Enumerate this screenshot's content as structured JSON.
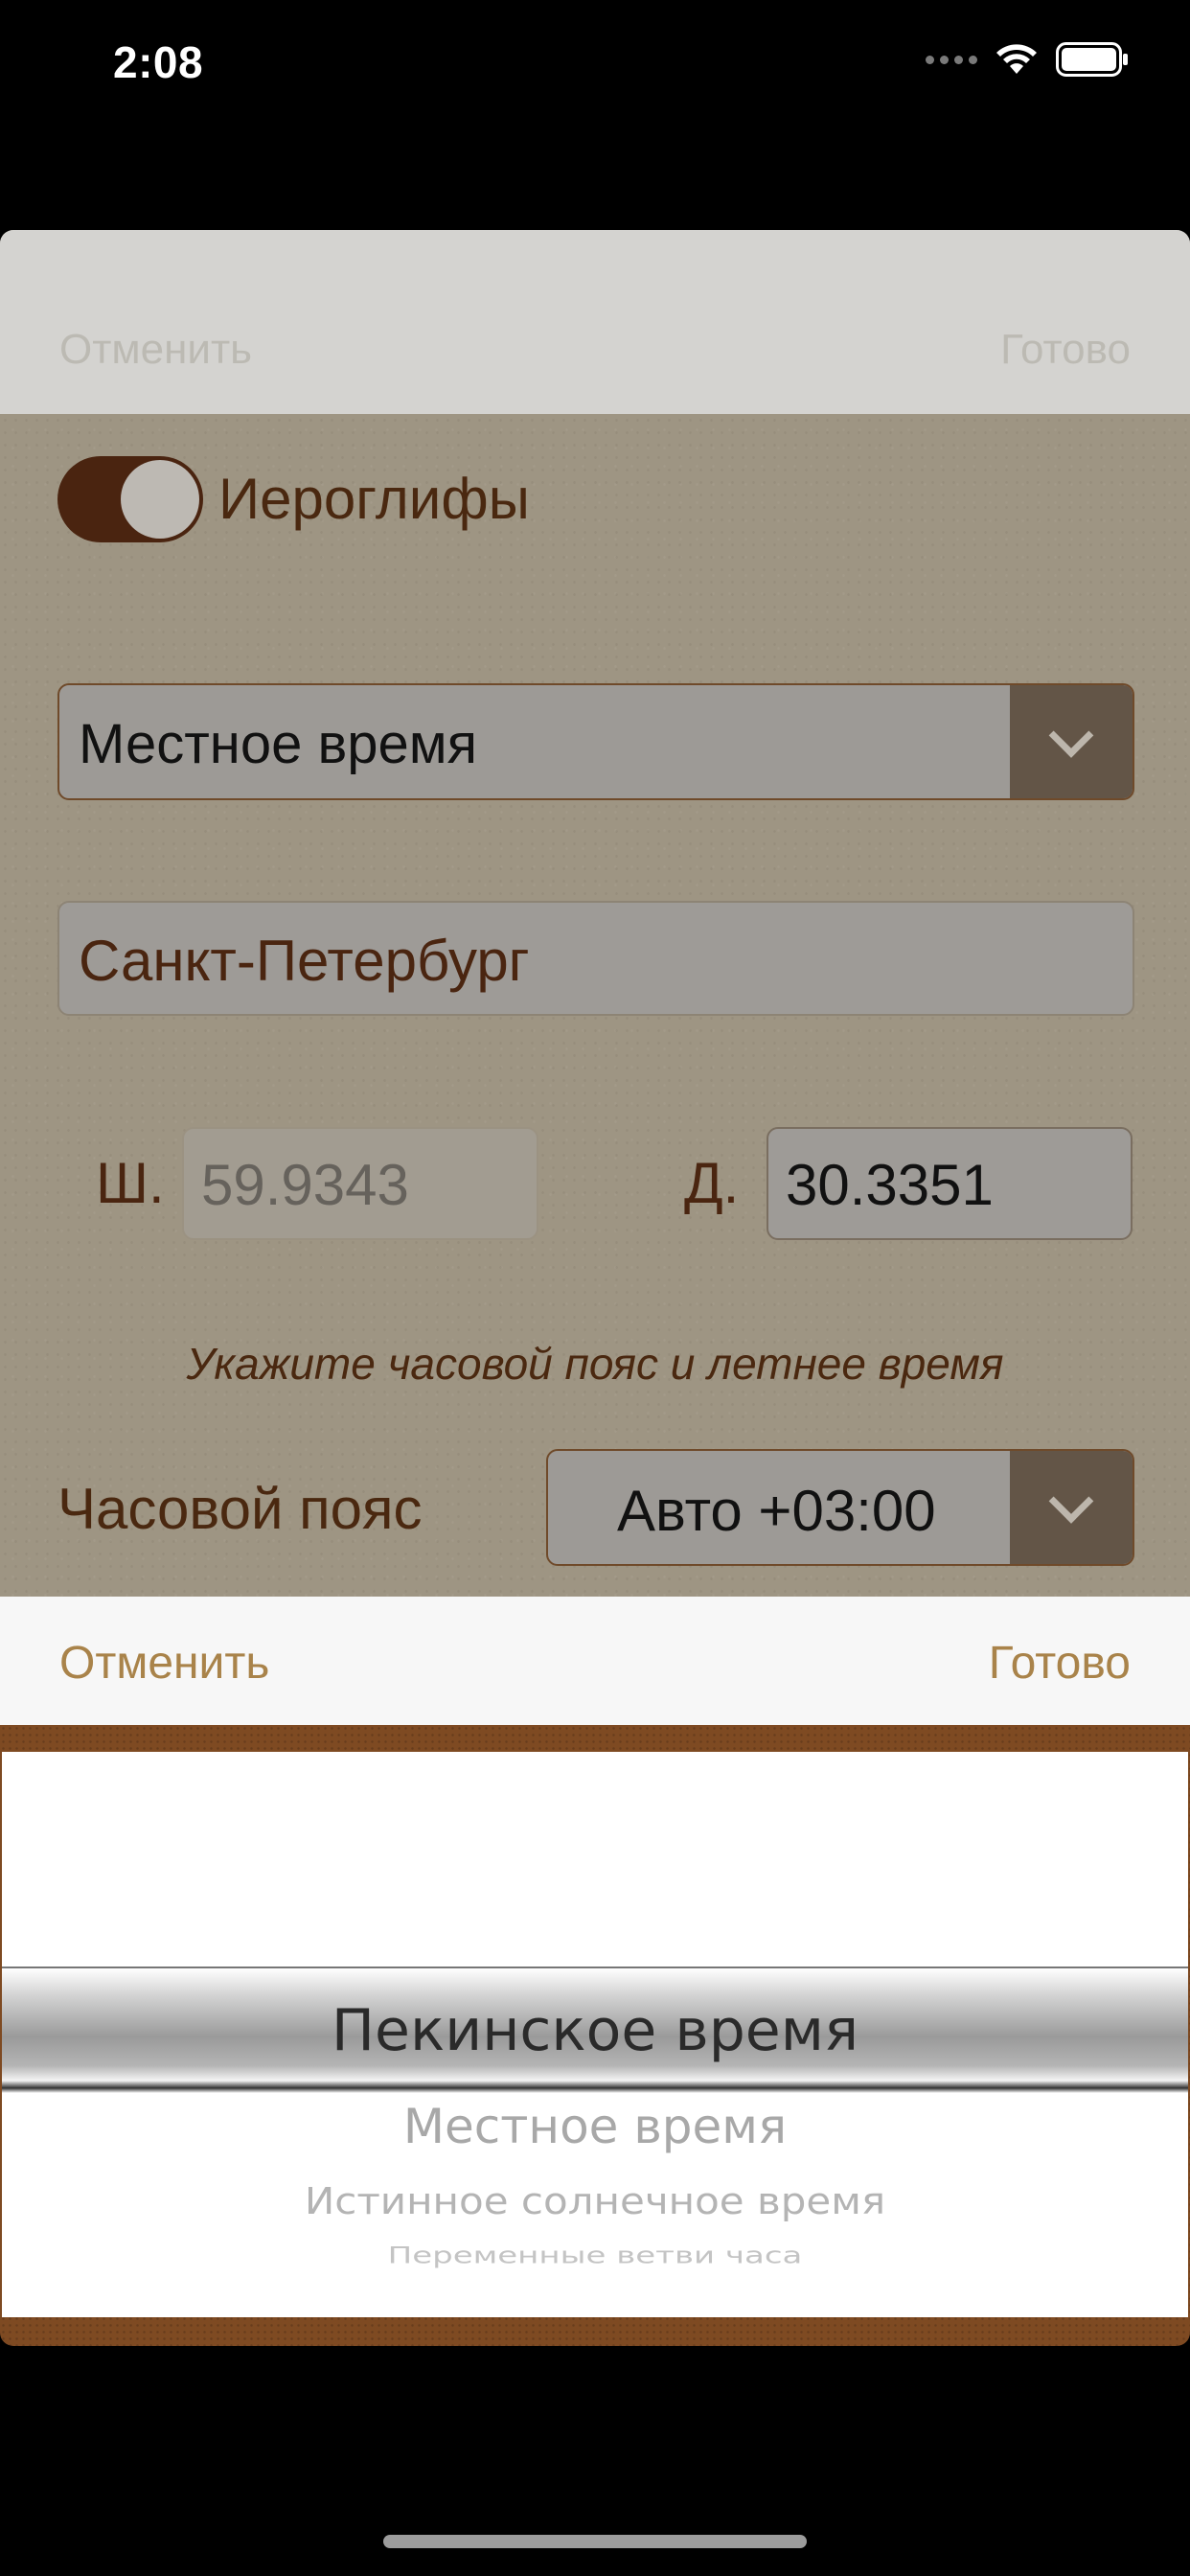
{
  "status_bar": {
    "time": "2:08"
  },
  "sheet": {
    "cancel": "Отменить",
    "done": "Готово",
    "toggle_label": "Иероглифы",
    "mode_select": "Местное время",
    "city": "Санкт-Петербург",
    "lat_label": "Ш.",
    "lat_value": "59.9343",
    "lon_label": "Д.",
    "lon_value": "30.3351",
    "hint": "Укажите часовой пояс и летнее время",
    "tz_label": "Часовой пояс",
    "tz_value": "Авто +03:00"
  },
  "picker": {
    "cancel": "Отменить",
    "done": "Готово",
    "options": [
      "Пекинское время",
      "Местное время",
      "Истинное солнечное время",
      "Переменные ветви часа"
    ]
  }
}
